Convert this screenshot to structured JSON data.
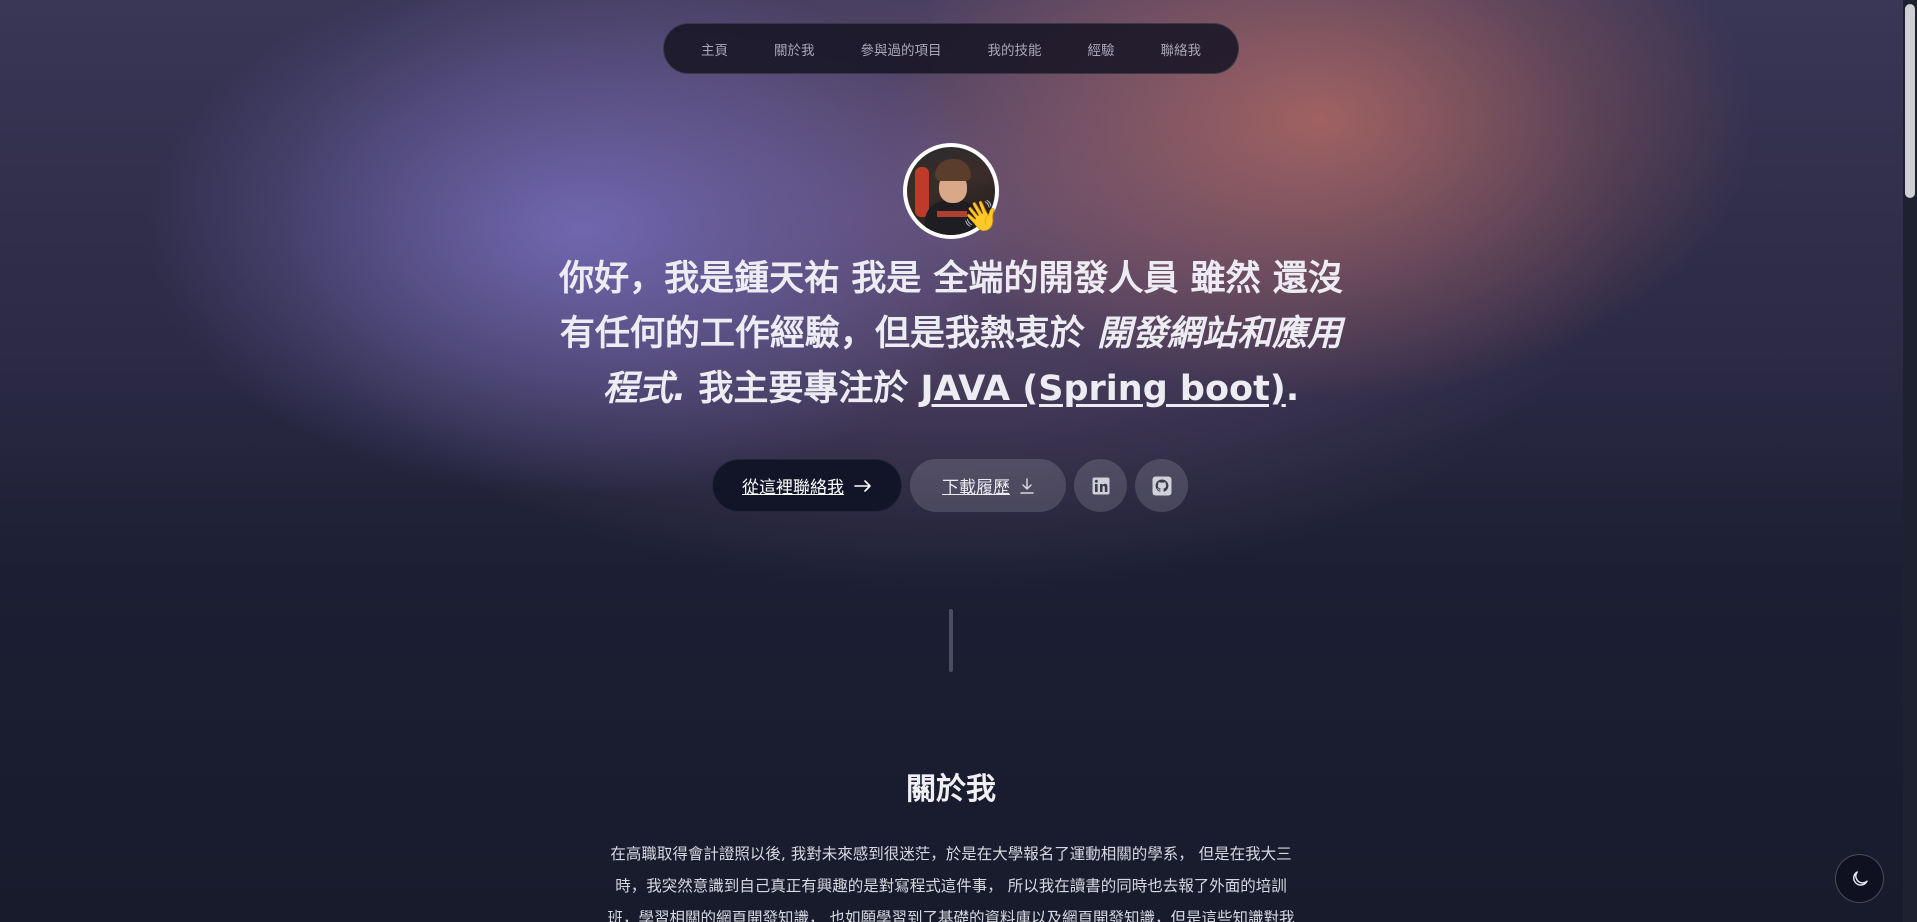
{
  "nav": {
    "items": [
      {
        "label": "主頁"
      },
      {
        "label": "關於我"
      },
      {
        "label": "參與過的項目"
      },
      {
        "label": "我的技能"
      },
      {
        "label": "經驗"
      },
      {
        "label": "聯絡我"
      }
    ]
  },
  "hero": {
    "wave_emoji": "👋",
    "greeting": "你好，我是鍾天祐",
    "part1": " 我是 ",
    "role": "全端的開發人員",
    "part2": " 雖然 ",
    "no_exp_bold": "還沒有",
    "part3": "任何的工作經驗，但是我熱衷於 ",
    "passion": "開發網站和應用程式.",
    "part4": " 我主要專注於 ",
    "focus": "JAVA (Spring boot)",
    "period": "."
  },
  "actions": {
    "contact_label": "從這裡聯絡我",
    "contact_icon": "arrow-right-icon",
    "resume_label": "下載履歷",
    "resume_icon": "download-icon",
    "linkedin_icon": "linkedin-icon",
    "github_icon": "github-icon"
  },
  "about": {
    "title": "關於我",
    "line1": "在高職取得會計證照以後, 我對未來感到很迷茫，於是在大學報名了運動相關的學系， 但是在我大三",
    "line2": "時，我突然意識到自己真正有興趣的是對寫程式這件事， 所以我在讀書的同時也去報了外面的培訓",
    "line3": "班，學習相關的網頁開發知識， 也如願學習到了基礎的資料庫以及網頁開發知識，但是這些知識對我"
  },
  "theme_toggle": {
    "icon": "moon-icon"
  }
}
